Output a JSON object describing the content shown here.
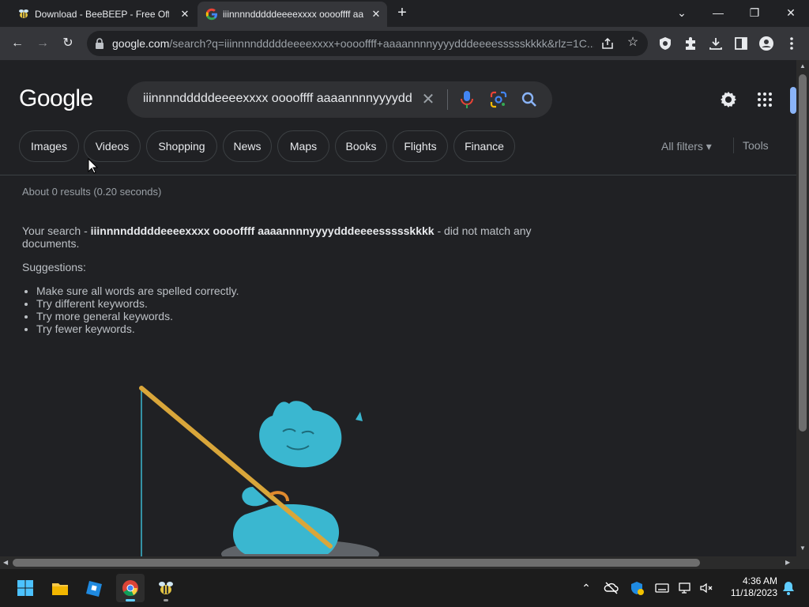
{
  "browser": {
    "tabs": [
      {
        "title": "Download - BeeBEEP - Free Offic",
        "favicon": "bee-icon",
        "active": false
      },
      {
        "title": "iiinnnndddddeeeexxxx ooooffff aa",
        "favicon": "google-g-icon",
        "active": true
      }
    ],
    "new_tab": "+",
    "window_controls": {
      "menu": "⌄",
      "minimize": "—",
      "restore": "❐",
      "close": "✕"
    },
    "toolbar": {
      "back": "←",
      "forward": "→",
      "reload": "↻",
      "star": "☆"
    },
    "address_bar": {
      "host": "google.com",
      "rest": "/search?q=iiinnnndddddeeeexxxx+ooooffff+aaaannnnyyyydddeeeessssskkkk&rlz=1C..."
    }
  },
  "search": {
    "logo": "Google",
    "query": "iiinnnndddddeeeexxxx ooooffff aaaannnnyyyyddd",
    "clear_glyph": "✕",
    "chips": [
      "Images",
      "Videos",
      "Shopping",
      "News",
      "Maps",
      "Books",
      "Flights",
      "Finance"
    ],
    "all_filters": "All filters ▾",
    "tools": "Tools",
    "stats": "About 0 results (0.20 seconds)",
    "no_match": {
      "prefix": "Your search - ",
      "term": "iiinnnndddddeeeexxxx ooooffff aaaannnnyyyydddeeeessssskkkk",
      "suffix": " - did not match any documents."
    },
    "suggestions_label": "Suggestions:",
    "tips": [
      "Make sure all words are spelled correctly.",
      "Try different keywords.",
      "Try more general keywords.",
      "Try fewer keywords."
    ]
  },
  "taskbar": {
    "apps": [
      "windows-start-icon",
      "file-explorer-icon",
      "app-icon",
      "chrome-icon",
      "beebeep-icon"
    ],
    "tray": {
      "chevron": "⌃"
    },
    "time": "4:36 AM",
    "date": "11/18/2023"
  },
  "colors": {
    "page_bg": "#202124",
    "chrome_toolbar": "#35363a",
    "chip_border": "#3c4043",
    "accent_blue": "#8ab4f8",
    "illustration_teal": "#3ab7d0"
  }
}
